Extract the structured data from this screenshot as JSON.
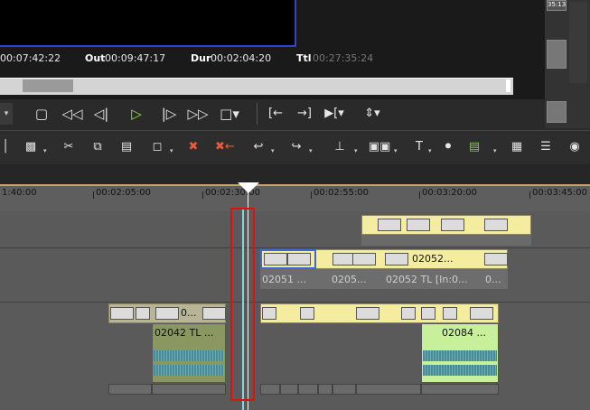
{
  "timecode": {
    "in_value": "00:07:42:22",
    "out_label": "Out",
    "out_value": "00:09:47:17",
    "dur_label": "Dur",
    "dur_value": "00:02:04:20",
    "ttl_label": "Ttl",
    "ttl_value": "00:27:35:24"
  },
  "side_thumbs": {
    "t1": "35:13",
    "t2": "",
    "t3": ""
  },
  "transport": {
    "icons": [
      "stop-icon",
      "rewind-icon",
      "step-back-icon",
      "play-icon",
      "step-forward-icon",
      "fast-forward-icon",
      "loop-icon",
      "mark-in-icon",
      "mark-out-icon",
      "insert-icon",
      "split-icon"
    ]
  },
  "ruler": {
    "labels": [
      "1:40:00",
      "00:02:05:00",
      "00:02:30:00",
      "00:02:55:00",
      "00:03:20:00",
      "00:03:45:00"
    ]
  },
  "clips": {
    "v1a_label": "0...",
    "a1a_label": "02042  TL ...",
    "a1b_label": "02084 ...",
    "v2a_label": "02051 ...",
    "v2b_label": "0205...",
    "v2c_label": "02052...",
    "v2c_sub": "02052  TL [In:0...",
    "v2d_sub": "0..."
  },
  "colors": {
    "clip_yellow": "#f4eda0",
    "audio_green": "#c8f09a",
    "playhead_marker": "#e01010",
    "play_green": "#9be24a",
    "in_out_border": "#2c44c8"
  }
}
